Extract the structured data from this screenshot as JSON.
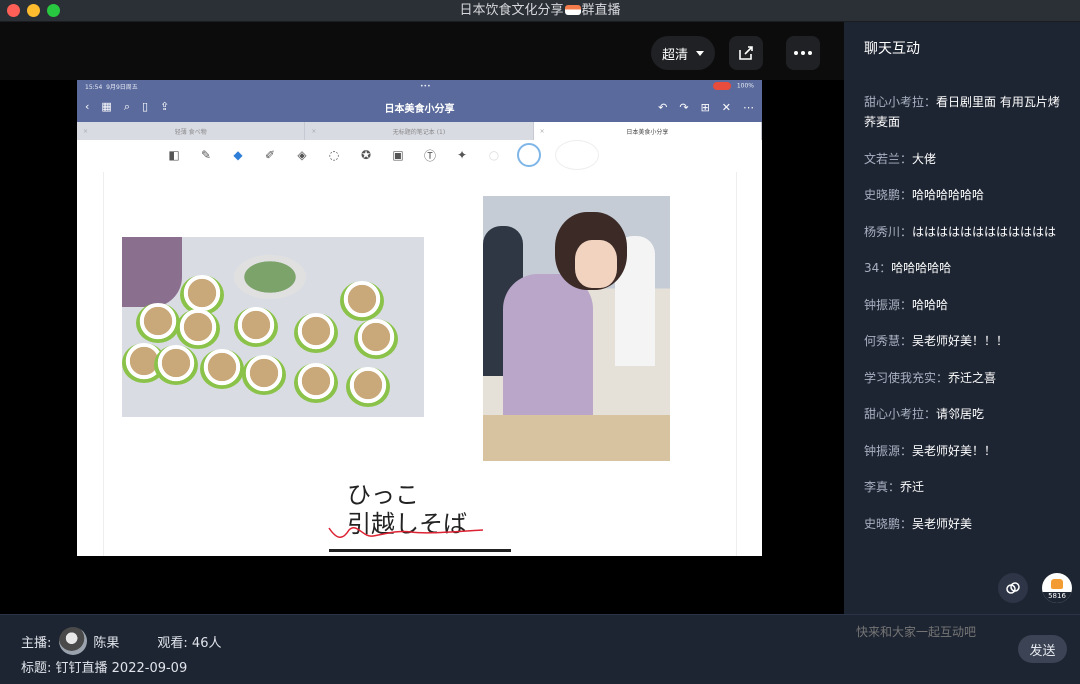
{
  "window": {
    "title": "日本饮食文化分享",
    "title_suffix": "群直播"
  },
  "player": {
    "quality_label": "超清"
  },
  "slide": {
    "status_time": "15:54",
    "status_date": "9月9日周五",
    "battery": "100%",
    "doc_title": "日本美食小分享",
    "tabs": [
      "轻薄 食べ物",
      "无标题的笔记本 (1)",
      "日本美食小分享"
    ],
    "handwriting_line1": "ひっこ",
    "handwriting_line2": "引越しそば"
  },
  "chat": {
    "title": "聊天互动",
    "messages": [
      {
        "user": "甜心小考拉：",
        "text": "看日剧里面 有用瓦片烤荞麦面"
      },
      {
        "user": "文若兰：",
        "text": "大佬"
      },
      {
        "user": "史晓鹏：",
        "text": "哈哈哈哈哈哈"
      },
      {
        "user": "杨秀川：",
        "text": "はははははははははははは"
      },
      {
        "user": "34：",
        "text": "哈哈哈哈哈"
      },
      {
        "user": "钟振源：",
        "text": "哈哈哈"
      },
      {
        "user": "何秀慧：",
        "text": "吴老师好美！！！"
      },
      {
        "user": "学习使我充实：",
        "text": "乔迁之喜"
      },
      {
        "user": "甜心小考拉：",
        "text": "请邻居吃"
      },
      {
        "user": "钟振源：",
        "text": "吴老师好美！！"
      },
      {
        "user": "李真：",
        "text": "乔迁"
      },
      {
        "user": "史晓鹏：",
        "text": "吴老师好美"
      }
    ],
    "like_count": "5816",
    "input_placeholder": "快来和大家一起互动吧",
    "send_label": "发送"
  },
  "info": {
    "host_label": "主播:",
    "host_name": "陈果",
    "viewers_label": "观看: 46人",
    "title_label": "标题:",
    "title_value": "钉钉直播 2022-09-09"
  },
  "colors": {
    "panel_bg": "#1e2532",
    "slide_header": "#5a6a9c"
  }
}
